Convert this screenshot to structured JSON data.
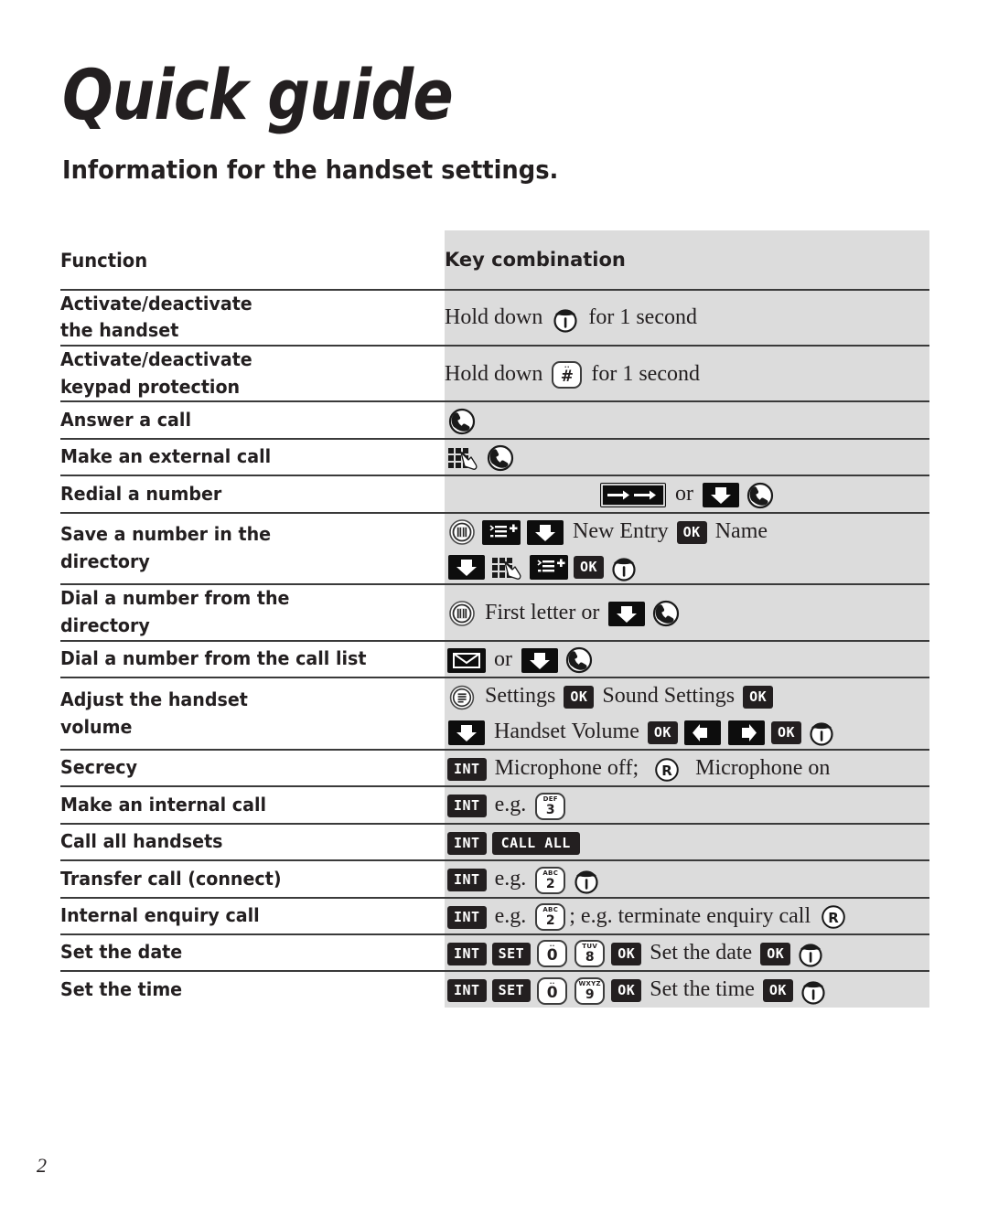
{
  "document": {
    "title": "Quick guide",
    "subtitle": "Information for the handset settings.",
    "page_number": "2"
  },
  "table": {
    "headers": {
      "function": "Function",
      "key_combination": "Key combination"
    },
    "rows": [
      {
        "function_lines": [
          "Activate/deactivate",
          "the handset"
        ],
        "key_lines": [
          [
            {
              "t": "text",
              "v": "Hold down "
            },
            {
              "t": "icon",
              "name": "power-handset-icon"
            },
            {
              "t": "text",
              "v": " for 1 second"
            }
          ]
        ]
      },
      {
        "function_lines": [
          "Activate/deactivate",
          "keypad protection"
        ],
        "key_lines": [
          [
            {
              "t": "text",
              "v": "Hold down "
            },
            {
              "t": "key",
              "alpha": "",
              "digit": "#"
            },
            {
              "t": "text",
              "v": " for 1 second"
            }
          ]
        ]
      },
      {
        "function_lines": [
          "Answer a call"
        ],
        "key_lines": [
          [
            {
              "t": "icon",
              "name": "answer-call-icon"
            }
          ]
        ]
      },
      {
        "function_lines": [
          "Make an external call"
        ],
        "key_lines": [
          [
            {
              "t": "icon",
              "name": "keypad-dial-icon"
            },
            {
              "t": "icon",
              "name": "answer-call-icon"
            }
          ]
        ]
      },
      {
        "function_lines": [
          "Redial a number"
        ],
        "key_lines": [
          [
            {
              "t": "icon",
              "name": "redial-arrow-key"
            },
            {
              "t": "text",
              "v": " or "
            },
            {
              "t": "icon",
              "name": "down-arrow-key"
            },
            {
              "t": "icon",
              "name": "answer-call-icon"
            }
          ]
        ],
        "center": true
      },
      {
        "function_lines": [
          "Save a number in the",
          "directory"
        ],
        "key_lines": [
          [
            {
              "t": "icon",
              "name": "directory-icon"
            },
            {
              "t": "icon",
              "name": "menu-list-add-key"
            },
            {
              "t": "icon",
              "name": "down-arrow-key"
            },
            {
              "t": "text",
              "v": " New Entry "
            },
            {
              "t": "btn",
              "label": "OK"
            },
            {
              "t": "text",
              "v": " Name"
            }
          ],
          [
            {
              "t": "icon",
              "name": "down-arrow-key"
            },
            {
              "t": "icon",
              "name": "keypad-dial-icon"
            },
            {
              "t": "icon",
              "name": "menu-list-add-key"
            },
            {
              "t": "btn",
              "label": "OK"
            },
            {
              "t": "icon",
              "name": "power-handset-icon"
            }
          ]
        ]
      },
      {
        "function_lines": [
          "Dial a number from the",
          "directory"
        ],
        "key_lines": [
          [
            {
              "t": "icon",
              "name": "directory-icon"
            },
            {
              "t": "text",
              "v": " First letter or "
            },
            {
              "t": "icon",
              "name": "down-arrow-key"
            },
            {
              "t": "icon",
              "name": "answer-call-icon"
            }
          ]
        ]
      },
      {
        "function_lines": [
          "Dial a number from the call list"
        ],
        "key_lines": [
          [
            {
              "t": "icon",
              "name": "call-list-envelope-key"
            },
            {
              "t": "text",
              "v": " or "
            },
            {
              "t": "icon",
              "name": "down-arrow-key"
            },
            {
              "t": "icon",
              "name": "answer-call-icon"
            }
          ]
        ]
      },
      {
        "function_lines": [
          "Adjust the handset",
          "volume"
        ],
        "key_lines": [
          [
            {
              "t": "icon",
              "name": "menu-icon"
            },
            {
              "t": "text",
              "v": " Settings "
            },
            {
              "t": "btn",
              "label": "OK"
            },
            {
              "t": "text",
              "v": " Sound Settings "
            },
            {
              "t": "btn",
              "label": "OK"
            }
          ],
          [
            {
              "t": "icon",
              "name": "down-arrow-key"
            },
            {
              "t": "text",
              "v": " Handset Volume "
            },
            {
              "t": "btn",
              "label": "OK"
            },
            {
              "t": "icon",
              "name": "left-arrow-key"
            },
            {
              "t": "icon",
              "name": "right-arrow-key"
            },
            {
              "t": "btn",
              "label": "OK"
            },
            {
              "t": "icon",
              "name": "power-handset-icon"
            }
          ]
        ]
      },
      {
        "function_lines": [
          "Secrecy"
        ],
        "key_lines": [
          [
            {
              "t": "btn",
              "label": "INT"
            },
            {
              "t": "text",
              "v": " Microphone off;  "
            },
            {
              "t": "icon",
              "name": "recall-r-icon"
            },
            {
              "t": "text",
              "v": "  Microphone on"
            }
          ]
        ]
      },
      {
        "function_lines": [
          "Make an internal call"
        ],
        "key_lines": [
          [
            {
              "t": "btn",
              "label": "INT"
            },
            {
              "t": "text",
              "v": " e.g. "
            },
            {
              "t": "key",
              "alpha": "DEF",
              "digit": "3"
            }
          ]
        ]
      },
      {
        "function_lines": [
          "Call all handsets"
        ],
        "key_lines": [
          [
            {
              "t": "btn",
              "label": "INT"
            },
            {
              "t": "btn",
              "label": "CALL ALL",
              "wide": true
            }
          ]
        ]
      },
      {
        "function_lines": [
          "Transfer call (connect)"
        ],
        "key_lines": [
          [
            {
              "t": "btn",
              "label": "INT"
            },
            {
              "t": "text",
              "v": " e.g. "
            },
            {
              "t": "key",
              "alpha": "ABC",
              "digit": "2"
            },
            {
              "t": "icon",
              "name": "power-handset-icon"
            }
          ]
        ]
      },
      {
        "function_lines": [
          "Internal enquiry call"
        ],
        "key_lines": [
          [
            {
              "t": "btn",
              "label": "INT"
            },
            {
              "t": "text",
              "v": " e.g. "
            },
            {
              "t": "key",
              "alpha": "ABC",
              "digit": "2"
            },
            {
              "t": "text",
              "v": "; e.g. terminate enquiry call "
            },
            {
              "t": "icon",
              "name": "recall-r-icon"
            }
          ]
        ]
      },
      {
        "function_lines": [
          "Set the date"
        ],
        "key_lines": [
          [
            {
              "t": "btn",
              "label": "INT"
            },
            {
              "t": "btn",
              "label": "SET"
            },
            {
              "t": "key",
              "alpha": "",
              "digit": "0"
            },
            {
              "t": "key",
              "alpha": "TUV",
              "digit": "8"
            },
            {
              "t": "btn",
              "label": "OK"
            },
            {
              "t": "text",
              "v": " Set the date "
            },
            {
              "t": "btn",
              "label": "OK"
            },
            {
              "t": "icon",
              "name": "power-handset-icon"
            }
          ]
        ]
      },
      {
        "function_lines": [
          "Set the time"
        ],
        "key_lines": [
          [
            {
              "t": "btn",
              "label": "INT"
            },
            {
              "t": "btn",
              "label": "SET"
            },
            {
              "t": "key",
              "alpha": "",
              "digit": "0"
            },
            {
              "t": "key",
              "alpha": "WXYZ",
              "digit": "9"
            },
            {
              "t": "btn",
              "label": "OK"
            },
            {
              "t": "text",
              "v": " Set the time "
            },
            {
              "t": "btn",
              "label": "OK"
            },
            {
              "t": "icon",
              "name": "power-handset-icon"
            }
          ]
        ]
      }
    ]
  },
  "colors": {
    "text": "#231f20",
    "key_column_background": "#dcdcdc",
    "button_dark": "#231f20",
    "rule": "#3a3a3a"
  }
}
